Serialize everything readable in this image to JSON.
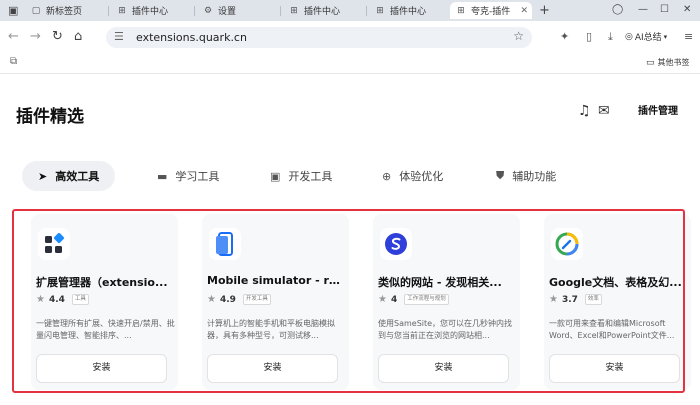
{
  "tabs": [
    {
      "label": "新标签页",
      "icon": "new-tab-icon"
    },
    {
      "label": "插件中心",
      "icon": "grid-icon"
    },
    {
      "label": "设置",
      "icon": "gear-icon"
    },
    {
      "label": "插件中心",
      "icon": "grid-icon"
    },
    {
      "label": "插件中心",
      "icon": "grid-icon"
    },
    {
      "label": "夸克-插件",
      "icon": "grid-icon",
      "active": true
    }
  ],
  "address": {
    "url": "extensions.quark.cn"
  },
  "toolbar": {
    "ai_summary_label": "AI总结"
  },
  "bookmarks": {
    "other_label": "其他书签"
  },
  "page": {
    "title": "插件精选",
    "manage_label": "插件管理"
  },
  "categories": [
    {
      "label": "高效工具",
      "icon": "send-icon",
      "active": true
    },
    {
      "label": "学习工具",
      "icon": "book-icon"
    },
    {
      "label": "开发工具",
      "icon": "code-icon"
    },
    {
      "label": "体验优化",
      "icon": "plus-circle-icon"
    },
    {
      "label": "辅助功能",
      "icon": "shield-icon"
    }
  ],
  "cards": [
    {
      "name": "扩展管理器（extensio...",
      "rating": "4.4",
      "tag": "工具",
      "desc": "一键管理所有扩展、快速开启/禁用、批量闪电管理、智能排序、...",
      "install_label": "安装",
      "logo": "extension-manager-logo"
    },
    {
      "name": "Mobile simulator - re...",
      "rating": "4.9",
      "tag": "开发工具",
      "desc": "计算机上的智能手机和平板电脑模拟器，具有多种型号，可测试移...",
      "install_label": "安装",
      "logo": "mobile-simulator-logo"
    },
    {
      "name": "类似的网站 - 发现相关...",
      "rating": "4",
      "tag": "工作流程与规划",
      "desc": "使用SameSite，您可以在几秒钟内找到与您当前正在浏览的网站相...",
      "install_label": "安装",
      "logo": "samesite-logo"
    },
    {
      "name": "Google文档、表格及幻...",
      "rating": "3.7",
      "tag": "效率",
      "desc": "一款可用来查看和编辑Microsoft Word、Excel和PowerPoint文件...",
      "install_label": "安装",
      "logo": "google-docs-logo"
    }
  ],
  "colors": {
    "highlight": "#e53240",
    "active_cat_bg": "#eef0f3"
  }
}
